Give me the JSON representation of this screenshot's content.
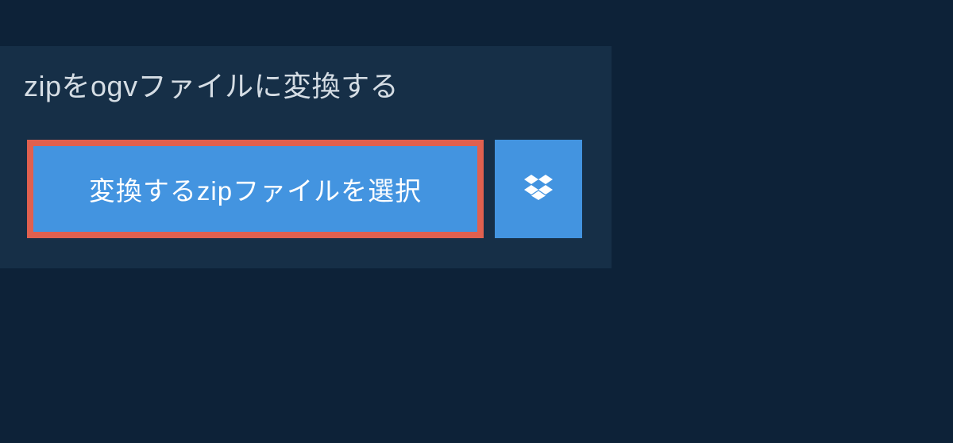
{
  "header": {
    "title": "zipをogvファイルに変換する"
  },
  "actions": {
    "select_file_label": "変換するzipファイルを選択",
    "dropbox_icon": "dropbox-icon"
  },
  "colors": {
    "background": "#0d2238",
    "panel": "#162f47",
    "button_primary": "#4394e0",
    "button_highlight_border": "#e0604f",
    "text_light": "#d5dde4",
    "text_white": "#ffffff"
  }
}
